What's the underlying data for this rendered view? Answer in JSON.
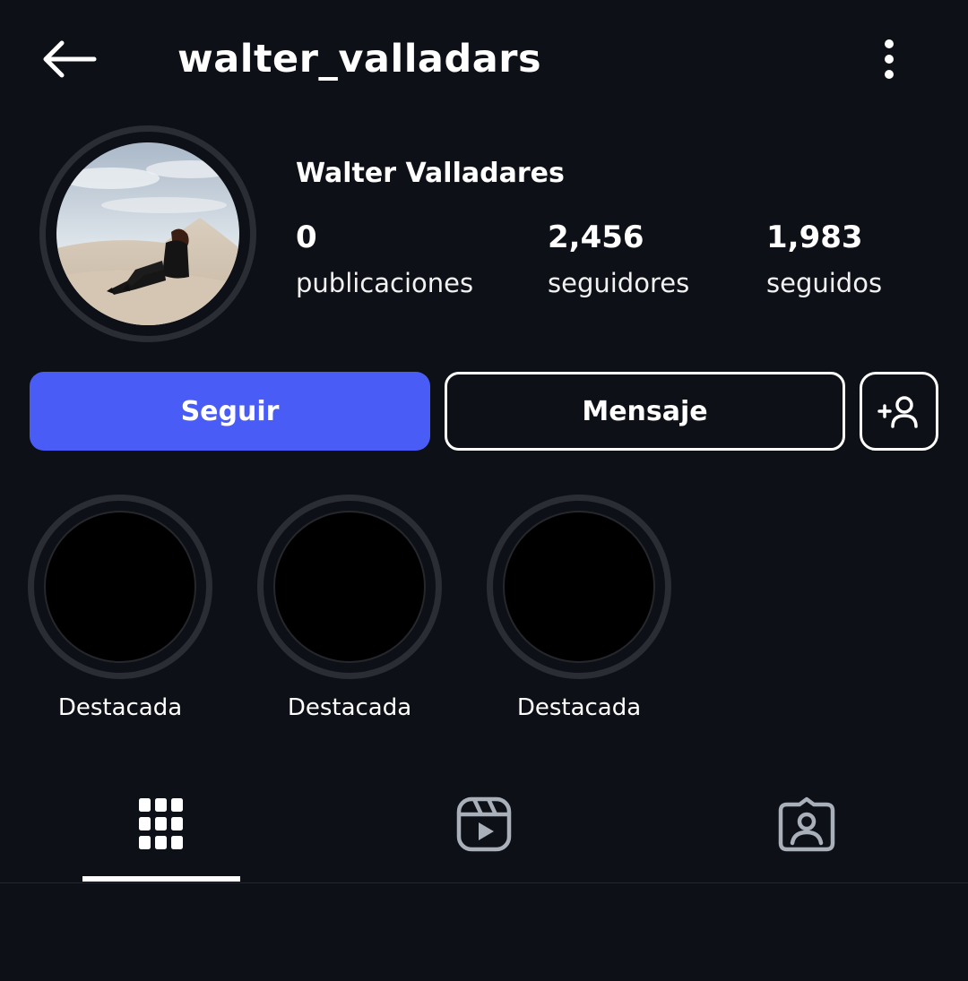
{
  "header": {
    "username": "walter_valladars",
    "back_icon": "arrow-left-icon",
    "more_icon": "more-vertical-icon"
  },
  "profile": {
    "full_name": "Walter Valladares",
    "avatar_description": "person sitting on sand dune"
  },
  "stats": [
    {
      "value": "0",
      "label": "publicaciones"
    },
    {
      "value": "2,456",
      "label": "seguidores"
    },
    {
      "value": "1,983",
      "label": "seguidos"
    }
  ],
  "actions": {
    "follow_label": "Seguir",
    "message_label": "Mensaje",
    "add_user_icon": "add-user-icon"
  },
  "highlights": [
    {
      "label": "Destacada"
    },
    {
      "label": "Destacada"
    },
    {
      "label": "Destacada"
    }
  ],
  "tabs": [
    {
      "name": "grid",
      "icon": "grid-icon",
      "active": true
    },
    {
      "name": "reels",
      "icon": "reels-icon",
      "active": false
    },
    {
      "name": "tagged",
      "icon": "tagged-icon",
      "active": false
    }
  ],
  "colors": {
    "background": "#0d1016",
    "accent": "#4a5cf6",
    "ring": "#2a2d34"
  }
}
